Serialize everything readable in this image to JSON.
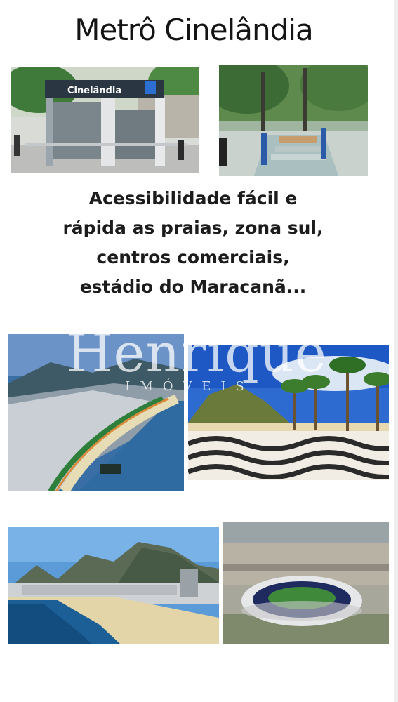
{
  "title": "Metrô Cinelândia",
  "station_sign": "Cinelândia",
  "tagline": {
    "lines": [
      "Acessibilidade fácil e",
      "rápida as praias, zona sul,",
      "centros comerciais,",
      "estádio do Maracanã..."
    ]
  },
  "watermark": {
    "name": "Henrique",
    "sub": "IMÓVEIS"
  },
  "photos": [
    "metro-entrance-photo",
    "metro-stairs-photo",
    "copacabana-aerial-photo",
    "copacabana-promenade-photo",
    "beach-mountains-photo",
    "maracana-stadium-photo"
  ]
}
